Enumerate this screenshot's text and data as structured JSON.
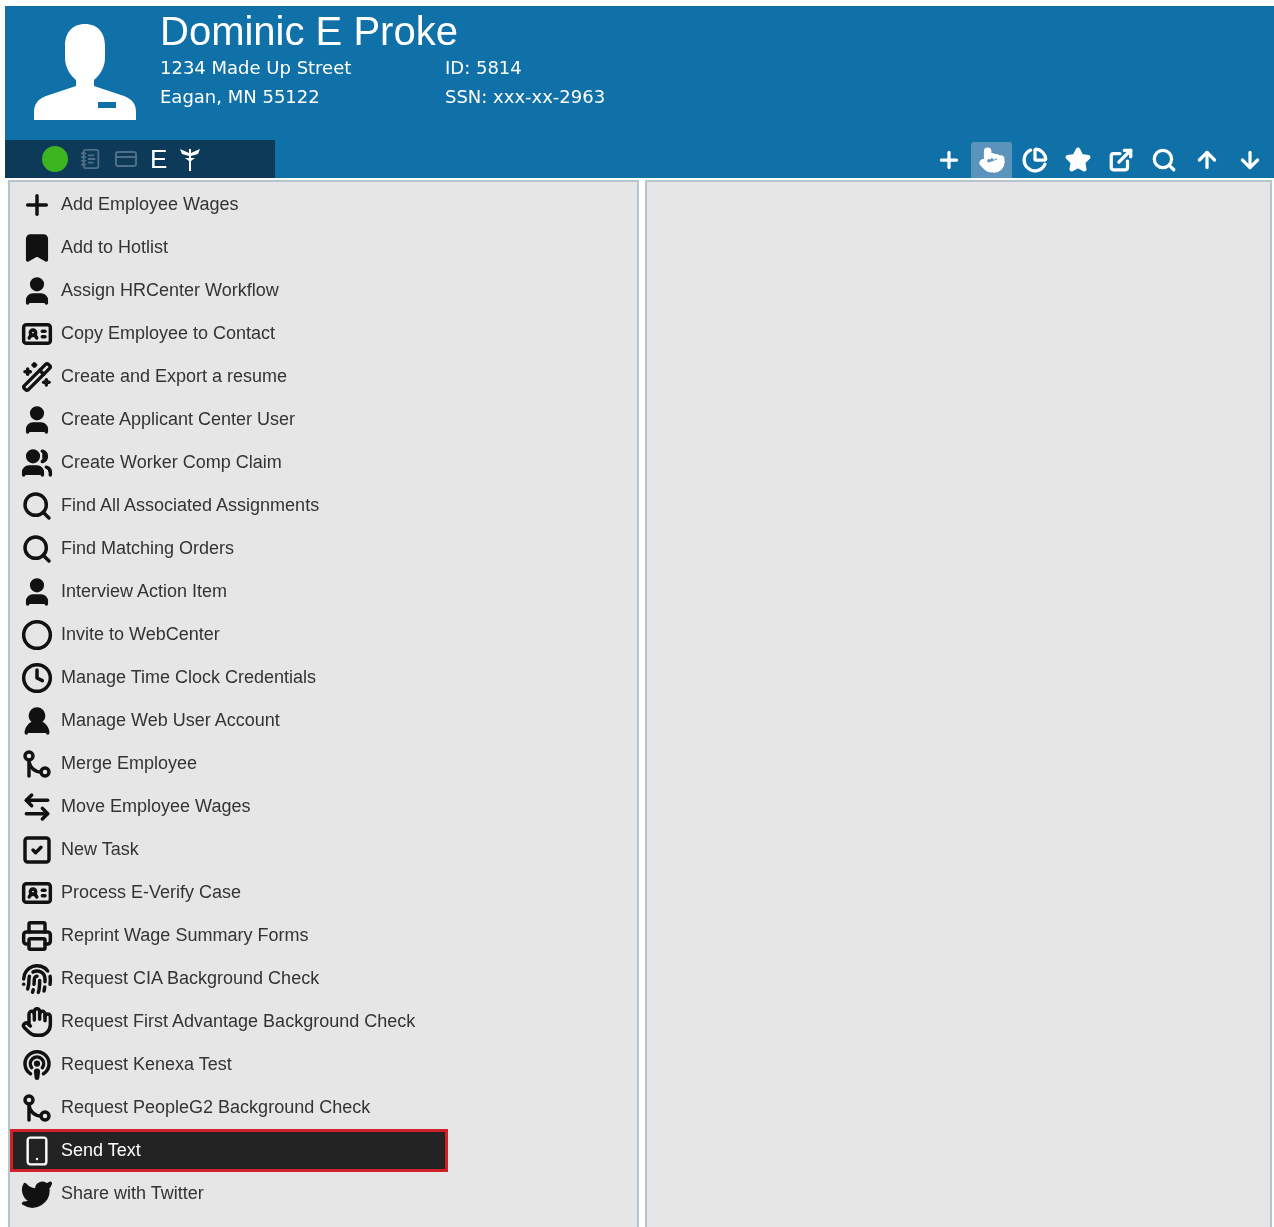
{
  "header": {
    "name": "Dominic E Proke",
    "address_line1": "1234 Made Up Street",
    "address_line2": "Eagan, MN 55122",
    "id": "ID: 5814",
    "ssn": "SSN: xxx-xx-2963"
  },
  "status_strip": [
    {
      "kind": "dot",
      "color": "#3cb521"
    },
    {
      "kind": "notepad"
    },
    {
      "kind": "card"
    },
    {
      "kind": "letter",
      "text": "E"
    },
    {
      "kind": "emblem"
    }
  ],
  "toolbar": [
    {
      "kind": "plus",
      "selected": false
    },
    {
      "kind": "pointer",
      "selected": true
    },
    {
      "kind": "pie",
      "selected": false
    },
    {
      "kind": "star",
      "selected": false
    },
    {
      "kind": "external",
      "selected": false
    },
    {
      "kind": "search",
      "selected": false
    },
    {
      "kind": "up",
      "selected": false
    },
    {
      "kind": "down",
      "selected": false
    }
  ],
  "actions": [
    {
      "label": "Add Employee Wages",
      "kind": "plus",
      "selected": false
    },
    {
      "label": "Add to Hotlist",
      "kind": "bookmark",
      "selected": false
    },
    {
      "label": "Assign HRCenter Workflow",
      "kind": "person",
      "selected": false
    },
    {
      "label": "Copy Employee to Contact",
      "kind": "card",
      "selected": false
    },
    {
      "label": "Create and Export a resume",
      "kind": "wand",
      "selected": false
    },
    {
      "label": "Create Applicant Center User",
      "kind": "person",
      "selected": false
    },
    {
      "label": "Create Worker Comp Claim",
      "kind": "people",
      "selected": false
    },
    {
      "label": "Find All Associated Assignments",
      "kind": "search",
      "selected": false
    },
    {
      "label": "Find Matching Orders",
      "kind": "search",
      "selected": false
    },
    {
      "label": "Interview Action Item",
      "kind": "person",
      "selected": false
    },
    {
      "label": "Invite to WebCenter",
      "kind": "ring",
      "selected": false
    },
    {
      "label": "Manage Time Clock Credentials",
      "kind": "clock",
      "selected": false
    },
    {
      "label": "Manage Web User Account",
      "kind": "globe-user",
      "selected": false
    },
    {
      "label": "Merge Employee",
      "kind": "merge",
      "selected": false
    },
    {
      "label": "Move Employee Wages",
      "kind": "swap",
      "selected": false
    },
    {
      "label": "New Task",
      "kind": "check",
      "selected": false
    },
    {
      "label": "Process E-Verify Case",
      "kind": "card",
      "selected": false
    },
    {
      "label": "Reprint Wage Summary Forms",
      "kind": "printer",
      "selected": false
    },
    {
      "label": "Request CIA Background Check",
      "kind": "fingerprint",
      "selected": false
    },
    {
      "label": "Request First Advantage Background Check",
      "kind": "hand",
      "selected": false
    },
    {
      "label": "Request Kenexa Test",
      "kind": "podcast",
      "selected": false
    },
    {
      "label": "Request PeopleG2 Background Check",
      "kind": "merge",
      "selected": false
    },
    {
      "label": "Send Text",
      "kind": "phone",
      "selected": true
    },
    {
      "label": "Share with Twitter",
      "kind": "twitter",
      "selected": false
    }
  ]
}
